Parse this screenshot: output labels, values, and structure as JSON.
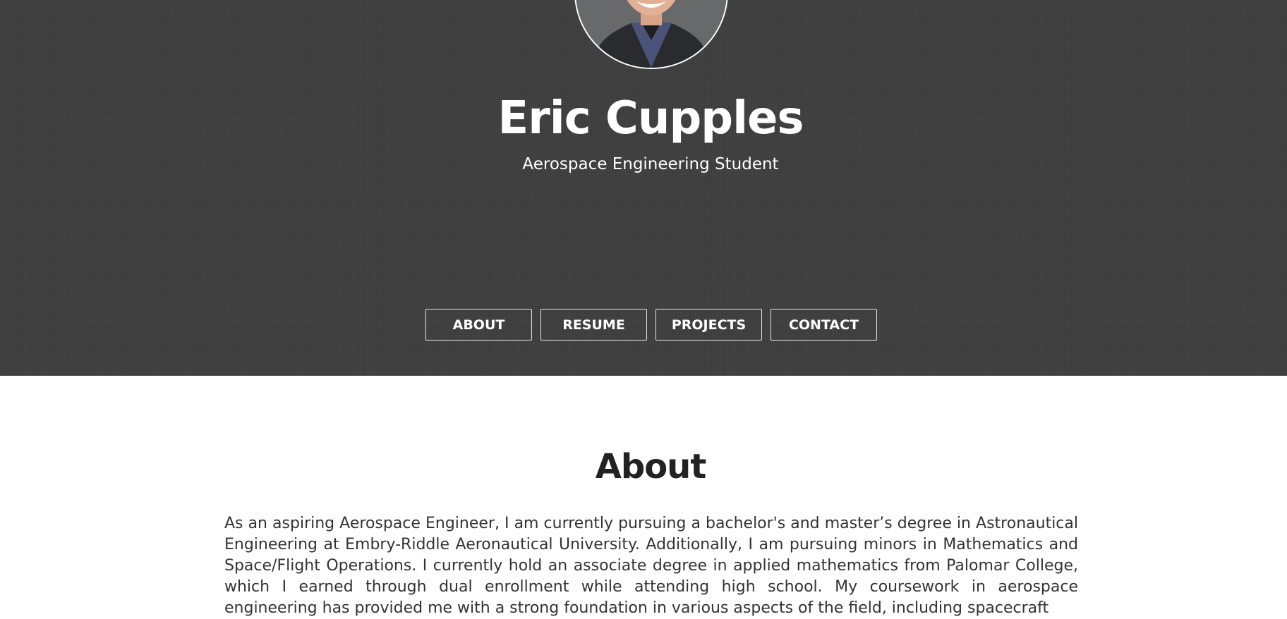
{
  "header": {
    "name": "Eric Cupples",
    "subtitle": "Aerospace Engineering Student",
    "avatar_icon": "profile-photo"
  },
  "nav": {
    "items": [
      {
        "label": "ABOUT"
      },
      {
        "label": "RESUME"
      },
      {
        "label": "PROJECTS"
      },
      {
        "label": "CONTACT"
      }
    ]
  },
  "about": {
    "title": "About",
    "body": "As an aspiring Aerospace Engineer, I am currently pursuing a bachelor's and master’s degree in Astronautical Engineering at Embry-Riddle Aeronautical University. Additionally, I am pursuing minors in Mathematics and Space/Flight Operations. I currently hold an associate degree in applied mathematics from Palomar College, which I earned through dual enrollment while attending high school. My coursework in aerospace engineering has provided me with a strong foundation in various aspects of the field, including spacecraft"
  },
  "colors": {
    "hero_bg": "#3e3e3e",
    "text_light": "#ffffff",
    "heading_dark": "#222222",
    "body_text": "#333333"
  }
}
